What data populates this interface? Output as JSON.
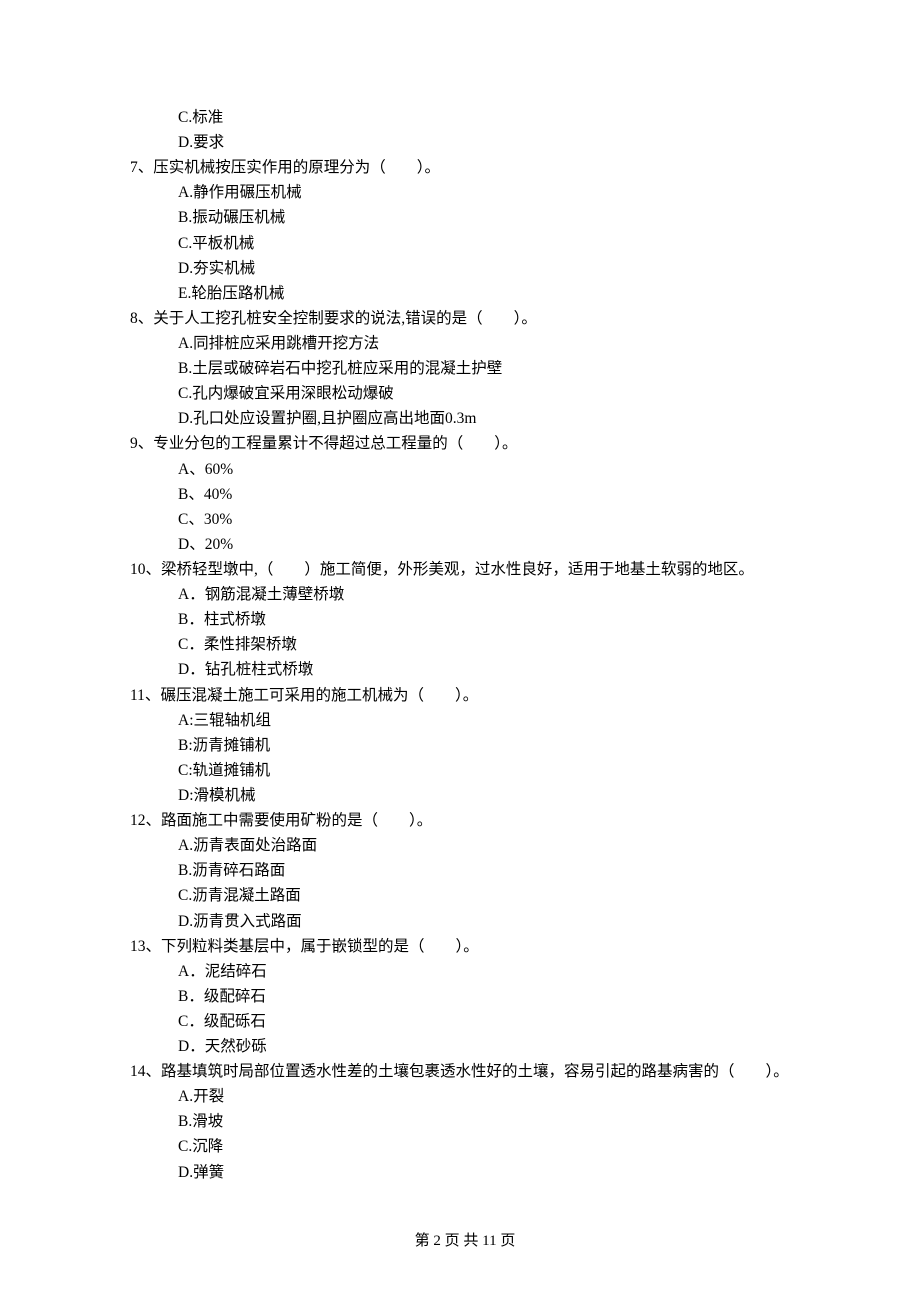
{
  "pre_options": [
    "C.标准",
    "D.要求"
  ],
  "questions": [
    {
      "num": "7、",
      "stem": "压实机械按压实作用的原理分为（　　）。",
      "options": [
        "A.静作用碾压机械",
        "B.振动碾压机械",
        "C.平板机械",
        "D.夯实机械",
        "E.轮胎压路机械"
      ]
    },
    {
      "num": "8、",
      "stem": "关于人工挖孔桩安全控制要求的说法,错误的是（　　）。",
      "options": [
        "A.同排桩应采用跳槽开挖方法",
        "B.土层或破碎岩石中挖孔桩应采用的混凝土护壁",
        "C.孔内爆破宜采用深眼松动爆破",
        "D.孔口处应设置护圈,且护圈应高出地面0.3m"
      ]
    },
    {
      "num": "9、",
      "stem": "专业分包的工程量累计不得超过总工程量的（　　）。",
      "options": [
        "A、60%",
        "B、40%",
        "C、30%",
        "D、20%"
      ]
    },
    {
      "num": "10、",
      "stem": "梁桥轻型墩中,（　　）施工简便，外形美观，过水性良好，适用于地基土软弱的地区。",
      "options": [
        "A．钢筋混凝土薄壁桥墩",
        "B．柱式桥墩",
        "C．柔性排架桥墩",
        "D．钻孔桩柱式桥墩"
      ]
    },
    {
      "num": "11、",
      "stem": "碾压混凝土施工可采用的施工机械为（　　）。",
      "options": [
        "A:三辊轴机组",
        "B:沥青摊铺机",
        "C:轨道摊铺机",
        "D:滑模机械"
      ]
    },
    {
      "num": "12、",
      "stem": "路面施工中需要使用矿粉的是（　　）。",
      "options": [
        "A.沥青表面处治路面",
        "B.沥青碎石路面",
        "C.沥青混凝土路面",
        "D.沥青贯入式路面"
      ]
    },
    {
      "num": "13、",
      "stem": "下列粒料类基层中，属于嵌锁型的是（　　）。",
      "options": [
        "A．泥结碎石",
        "B．级配碎石",
        "C．级配砾石",
        "D．天然砂砾"
      ]
    },
    {
      "num": "14、",
      "stem": "路基填筑时局部位置透水性差的土壤包裹透水性好的土壤，容易引起的路基病害的（　　）。",
      "options": [
        "A.开裂",
        "B.滑坡",
        "C.沉降",
        "D.弹簧"
      ]
    }
  ],
  "footer": "第 2 页 共 11 页"
}
